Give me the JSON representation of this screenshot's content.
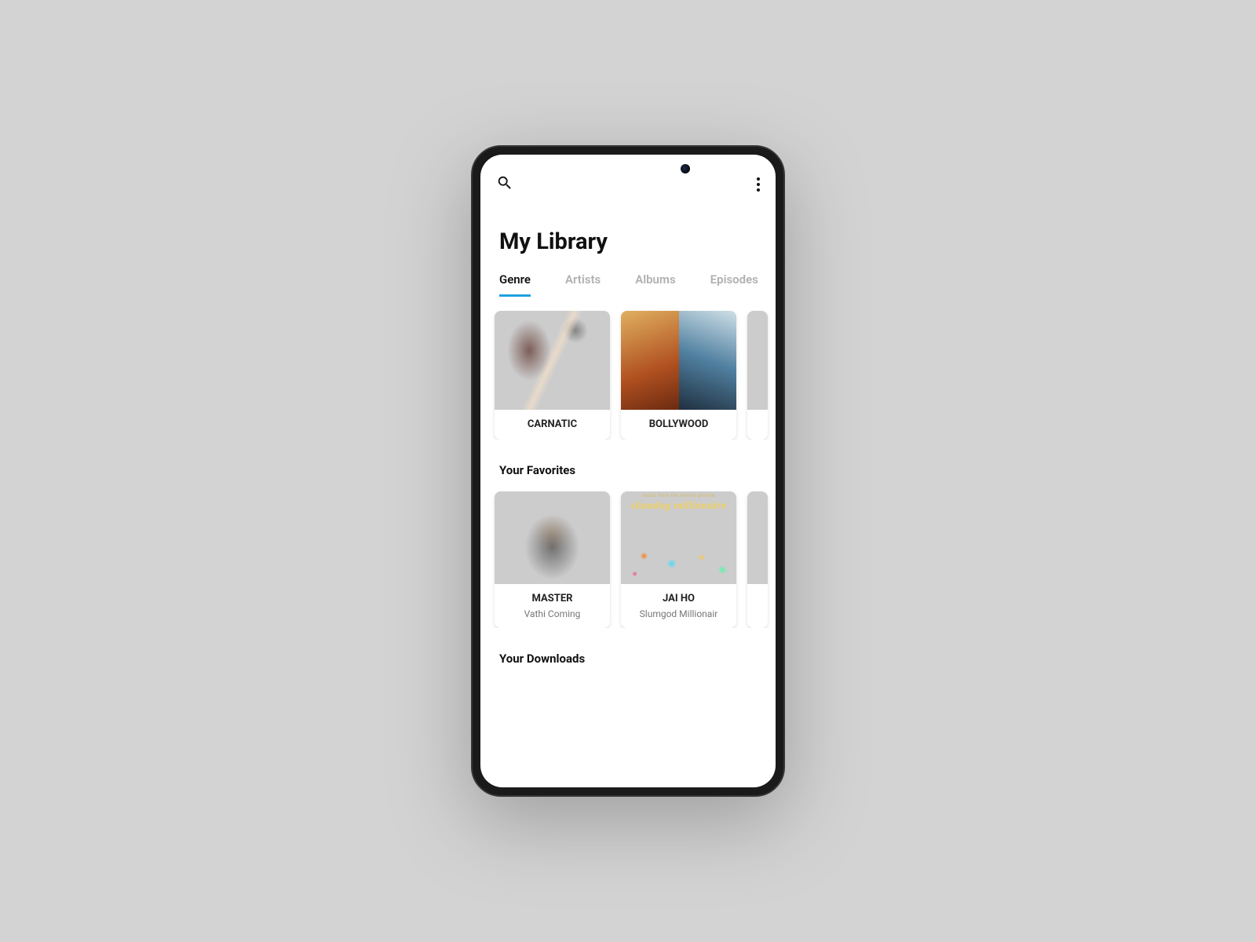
{
  "page_title": "My Library",
  "tabs": [
    {
      "label": "Genre",
      "active": true
    },
    {
      "label": "Artists",
      "active": false
    },
    {
      "label": "Albums",
      "active": false
    },
    {
      "label": "Episodes",
      "active": false
    }
  ],
  "genres": [
    {
      "name": "CARNATIC"
    },
    {
      "name": "BOLLYWOOD"
    }
  ],
  "sections": {
    "favorites_title": "Your Favorites",
    "downloads_title": "Your Downloads"
  },
  "favorites": [
    {
      "title": "MASTER",
      "subtitle": "Vathi Coming"
    },
    {
      "title": "JAI HO",
      "subtitle": "Slumgod Millionair"
    }
  ],
  "jaiho_art": {
    "tagline": "music from the motion picture",
    "logo": "slumdog millionaire"
  }
}
